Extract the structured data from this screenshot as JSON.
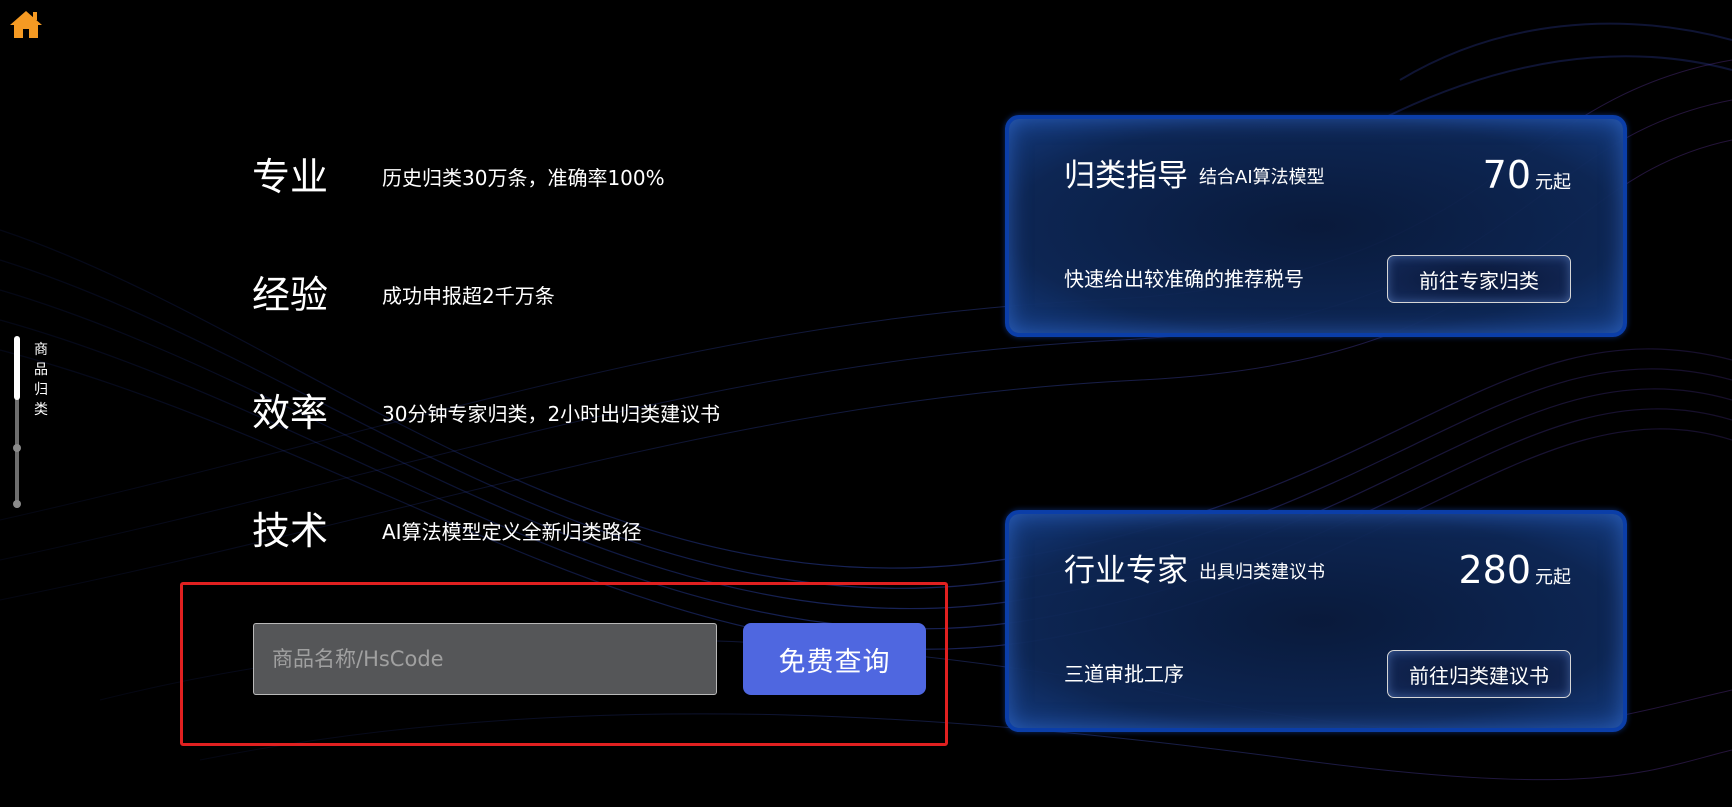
{
  "nav": {
    "home_icon": "home-icon",
    "home_color": "#f59a23",
    "side_label": "商品归类"
  },
  "features": [
    {
      "title": "专业",
      "desc": "历史归类30万条，准确率100%"
    },
    {
      "title": "经验",
      "desc": "成功申报超2千万条"
    },
    {
      "title": "效率",
      "desc": "30分钟专家归类，2小时出归类建议书"
    },
    {
      "title": "技术",
      "desc": "AI算法模型定义全新归类路径"
    }
  ],
  "search": {
    "placeholder": "商品名称/HsCode",
    "value": "",
    "button_label": "免费查询",
    "button_color": "#4f67e0",
    "frame_color": "#e02020"
  },
  "cards": [
    {
      "title": "归类指导",
      "subtitle": "结合AI算法模型",
      "price": "70",
      "price_unit": "元起",
      "desc": "快速给出较准确的推荐税号",
      "button_label": "前往专家归类"
    },
    {
      "title": "行业专家",
      "subtitle": "出具归类建议书",
      "price": "280",
      "price_unit": "元起",
      "desc": "三道审批工序",
      "button_label": "前往归类建议书"
    }
  ]
}
